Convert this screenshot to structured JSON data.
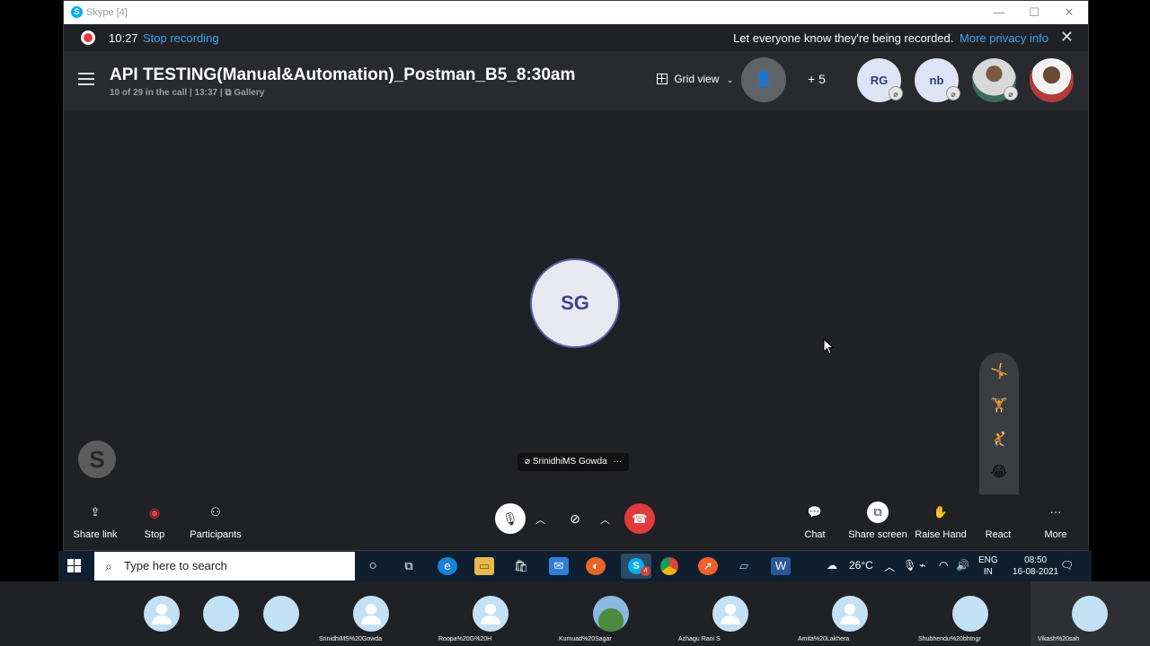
{
  "window": {
    "title": "Skype [4]",
    "min_icon": "minimize-icon",
    "max_icon": "maximize-icon",
    "close_icon": "close-icon"
  },
  "recording": {
    "time": "10:27",
    "stop_label": "Stop recording",
    "notice": "Let everyone know they're being recorded.",
    "privacy_link": "More privacy info"
  },
  "call": {
    "title": "API TESTING(Manual&Automation)_Postman_B5_8:30am",
    "subtitle_count": "10 of 29 in the call | 13:37 |",
    "subtitle_view": "Gallery",
    "grid_view_label": "Grid view",
    "plus_count": "+ 5",
    "header_avatars": [
      {
        "initials": "RG",
        "muted": true
      },
      {
        "initials": "nb",
        "muted": true
      },
      {
        "initials": "",
        "muted": true,
        "photo": true
      },
      {
        "initials": "",
        "muted": false,
        "photo": true
      }
    ]
  },
  "stage": {
    "speaker_initials": "SG",
    "speaker_name": "SrinidhiMS Gowda",
    "more_glyph": "···"
  },
  "controls": {
    "share_link": "Share link",
    "stop": "Stop",
    "participants": "Participants",
    "chat": "Chat",
    "share_screen": "Share screen",
    "raise_hand": "Raise Hand",
    "react": "React",
    "more": "More"
  },
  "taskbar": {
    "search_placeholder": "Type here to search",
    "weather": "26°C",
    "lang_line1": "ENG",
    "lang_line2": "IN",
    "time": "08:50",
    "date": "16-08-2021",
    "skype_badge": "4"
  },
  "strip": {
    "participants": [
      {
        "label": "",
        "photo": false
      },
      {
        "label": "",
        "photo": true
      },
      {
        "label": "",
        "photo": true
      },
      {
        "label": "SrinidhiMS%20Gowda",
        "photo": false
      },
      {
        "label": "Roopa%20G%20H",
        "photo": false
      },
      {
        "label": "Kumuad%20Sagar",
        "photo": true
      },
      {
        "label": "Azhagu Rani S",
        "photo": false
      },
      {
        "label": "Amita%20Lakhera",
        "photo": false
      },
      {
        "label": "Shubhendu%20bhtngr",
        "photo": true
      },
      {
        "label": "Vikash%20sah",
        "photo": true
      }
    ]
  },
  "colors": {
    "accent": "#3ea4f0",
    "record_red": "#e63b3b",
    "call_bg": "#202124",
    "taskbar_bg": "#0f1f2f"
  }
}
